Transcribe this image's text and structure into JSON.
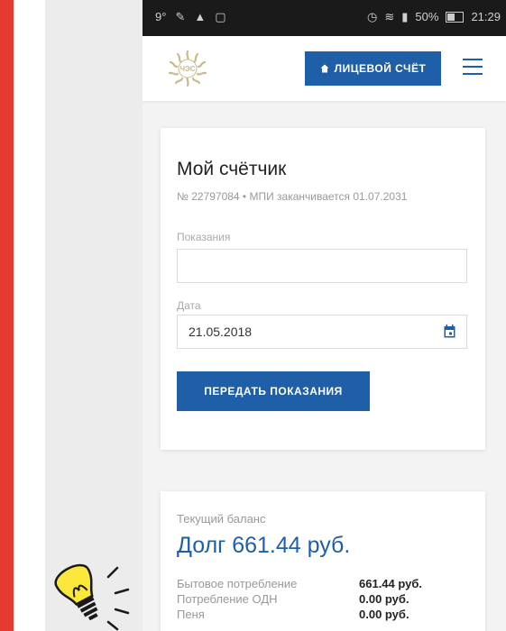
{
  "status_bar": {
    "temperature": "9°",
    "battery_percent": "50%",
    "time": "21:29"
  },
  "header": {
    "logo_text": "ЧЭС",
    "account_button_label": "ЛИЦЕВОЙ СЧЁТ",
    "account_button_icon": "home-icon",
    "menu_icon": "hamburger-menu-icon"
  },
  "meter_card": {
    "title": "Мой счётчик",
    "subtitle": "№ 22797084 • МПИ заканчивается 01.07.2031",
    "readings_label": "Показания",
    "readings_value": "",
    "date_label": "Дата",
    "date_value": "21.05.2018",
    "submit_label": "ПЕРЕДАТЬ ПОКАЗАНИЯ"
  },
  "balance_card": {
    "label": "Текущий баланс",
    "debt": "Долг 661.44 руб.",
    "rows": [
      {
        "name": "Бытовое потребление",
        "value": "661.44 руб."
      },
      {
        "name": "Потребление ОДН",
        "value": "0.00 руб."
      },
      {
        "name": "Пеня",
        "value": "0.00 руб."
      }
    ]
  },
  "colors": {
    "accent": "#1f5fa8",
    "side_stripe": "#e53a2f",
    "background_panel": "#ececec",
    "status_bar": "#1a1a1a"
  }
}
